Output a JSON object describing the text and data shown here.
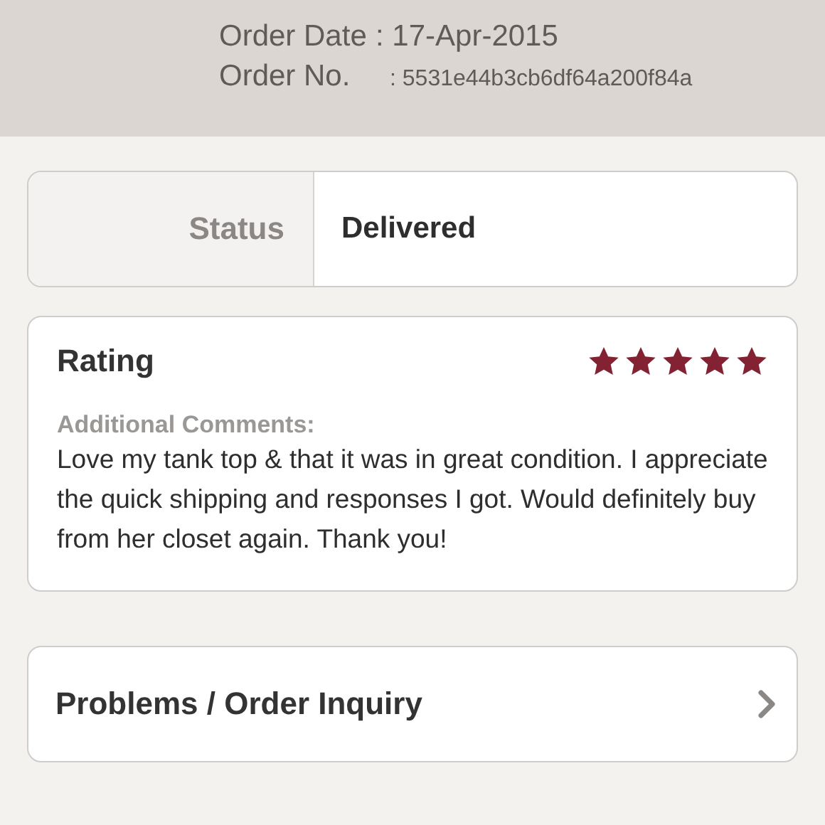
{
  "order": [
    {
      "label": "Order Date",
      "value": ": 17-Apr-2015",
      "kind": "date"
    },
    {
      "label": "Order No.",
      "value": ": 5531e44b3cb6df64a200f84a",
      "kind": "id"
    }
  ],
  "status": {
    "label": "Status",
    "value": "Delivered"
  },
  "rating": {
    "title": "Rating",
    "stars": 5,
    "comments_label": "Additional Comments:",
    "comments": "Love my tank top & that it was in great condition. I appreciate the quick shipping and responses I got. Would definitely buy from her closet again. Thank you!"
  },
  "link": {
    "label": "Problems / Order Inquiry"
  }
}
